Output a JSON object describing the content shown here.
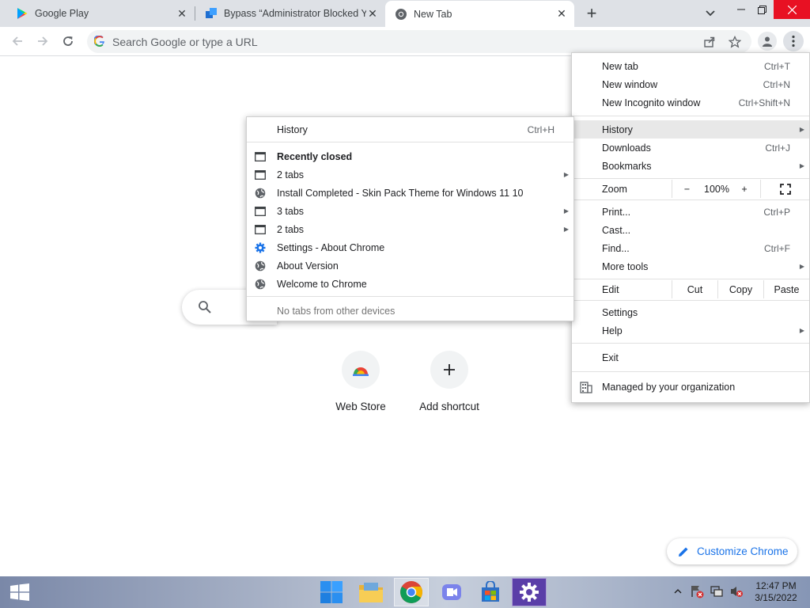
{
  "tabs": [
    {
      "title": "Google Play",
      "icon": "google-play-icon",
      "active": false
    },
    {
      "title": "Bypass “Administrator Blocked Yo",
      "icon": "blue-squares-icon",
      "active": false
    },
    {
      "title": "New Tab",
      "icon": "chrome-icon",
      "active": true
    }
  ],
  "omnibox": {
    "placeholder": "Search Google or type a URL"
  },
  "main_menu": {
    "new_tab": {
      "label": "New tab",
      "shortcut": "Ctrl+T"
    },
    "new_window": {
      "label": "New window",
      "shortcut": "Ctrl+N"
    },
    "new_incognito": {
      "label": "New Incognito window",
      "shortcut": "Ctrl+Shift+N"
    },
    "history": {
      "label": "History"
    },
    "downloads": {
      "label": "Downloads",
      "shortcut": "Ctrl+J"
    },
    "bookmarks": {
      "label": "Bookmarks"
    },
    "zoom": {
      "label": "Zoom",
      "minus": "−",
      "level": "100%",
      "plus": "+"
    },
    "print": {
      "label": "Print...",
      "shortcut": "Ctrl+P"
    },
    "cast": {
      "label": "Cast..."
    },
    "find": {
      "label": "Find...",
      "shortcut": "Ctrl+F"
    },
    "more_tools": {
      "label": "More tools"
    },
    "edit": {
      "label": "Edit",
      "cut": "Cut",
      "copy": "Copy",
      "paste": "Paste"
    },
    "settings": {
      "label": "Settings"
    },
    "help": {
      "label": "Help"
    },
    "exit": {
      "label": "Exit"
    },
    "managed": {
      "label": "Managed by your organization"
    }
  },
  "history_menu": {
    "history": {
      "label": "History",
      "shortcut": "Ctrl+H"
    },
    "recently_closed": "Recently closed",
    "items": [
      {
        "label": "2 tabs",
        "icon": "window-icon",
        "submenu": true
      },
      {
        "label": "Install Completed - Skin Pack Theme for Windows 11  10",
        "icon": "globe-icon",
        "submenu": false
      },
      {
        "label": "3 tabs",
        "icon": "window-icon",
        "submenu": true
      },
      {
        "label": "2 tabs",
        "icon": "window-icon",
        "submenu": true
      },
      {
        "label": "Settings - About Chrome",
        "icon": "settings-gear-icon",
        "submenu": false
      },
      {
        "label": "About Version",
        "icon": "globe-icon",
        "submenu": false
      },
      {
        "label": "Welcome to Chrome",
        "icon": "globe-icon",
        "submenu": false
      }
    ],
    "no_tabs": "No tabs from other devices"
  },
  "shortcuts": [
    {
      "label": "Web Store",
      "icon": "web-store-icon"
    },
    {
      "label": "Add shortcut",
      "icon": "plus-icon"
    }
  ],
  "customize": {
    "label": "Customize Chrome"
  },
  "taskbar": {
    "time": "12:47 PM",
    "date": "3/15/2022"
  },
  "colors": {
    "accent": "#1a73e8",
    "close_hover": "#e81123",
    "tabstrip": "#dee1e6"
  }
}
